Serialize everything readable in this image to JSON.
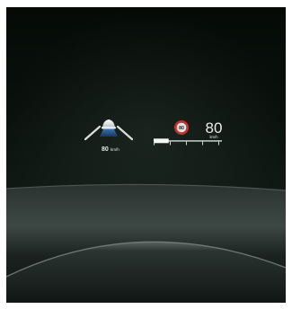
{
  "hud": {
    "set_speed_label": "80",
    "set_speed_unit": "km/h",
    "speed_limit_sign_value": "80",
    "speed_value": "80",
    "speed_unit": "km/h",
    "speed_bar_fraction": 0.22
  },
  "icons": {
    "cruise_control": "adaptive-cruise-car-icon",
    "speed_limit": "speed-limit-sign-icon"
  },
  "colors": {
    "hud_white": "#e7ecea",
    "cruise_blue": "#4a8fd8",
    "sign_red": "#c8312c"
  }
}
